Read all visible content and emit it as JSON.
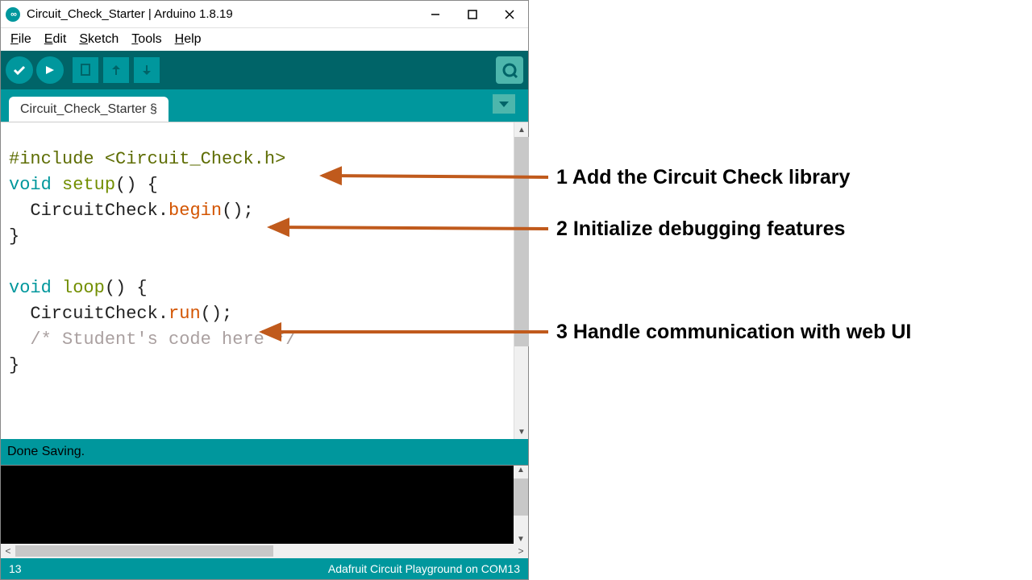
{
  "titlebar": {
    "app_icon_glyph": "∞",
    "title": "Circuit_Check_Starter | Arduino 1.8.19"
  },
  "menubar": {
    "file": "File",
    "edit": "Edit",
    "sketch": "Sketch",
    "tools": "Tools",
    "help": "Help"
  },
  "toolbar": {
    "verify_name": "verify-button",
    "upload_name": "upload-button",
    "new_name": "new-sketch-button",
    "open_name": "open-sketch-button",
    "save_name": "save-sketch-button",
    "serial_name": "serial-monitor-button"
  },
  "tab": {
    "label": "Circuit_Check_Starter §"
  },
  "code": {
    "l1_pp1": "#include",
    "l1_pp2": "<Circuit_Check.h>",
    "l2_kw": "void",
    "l2_fn": "setup",
    "l2_rest": "() {",
    "l3_a": "  CircuitCheck.",
    "l3_call": "begin",
    "l3_b": "();",
    "l4": "}",
    "l6_kw": "void",
    "l6_fn": "loop",
    "l6_rest": "() {",
    "l7_a": "  CircuitCheck.",
    "l7_call": "run",
    "l7_b": "();",
    "l8_comment": "  /* Student's code here */",
    "l9": "}"
  },
  "status": {
    "text": "Done Saving."
  },
  "infobar": {
    "line": "13",
    "board": "Adafruit Circuit Playground on COM13"
  },
  "annotations": {
    "a1": "1 Add the Circuit Check library",
    "a2": "2 Initialize debugging features",
    "a3": "3 Handle communication with web UI",
    "color": "#c05a1c"
  }
}
